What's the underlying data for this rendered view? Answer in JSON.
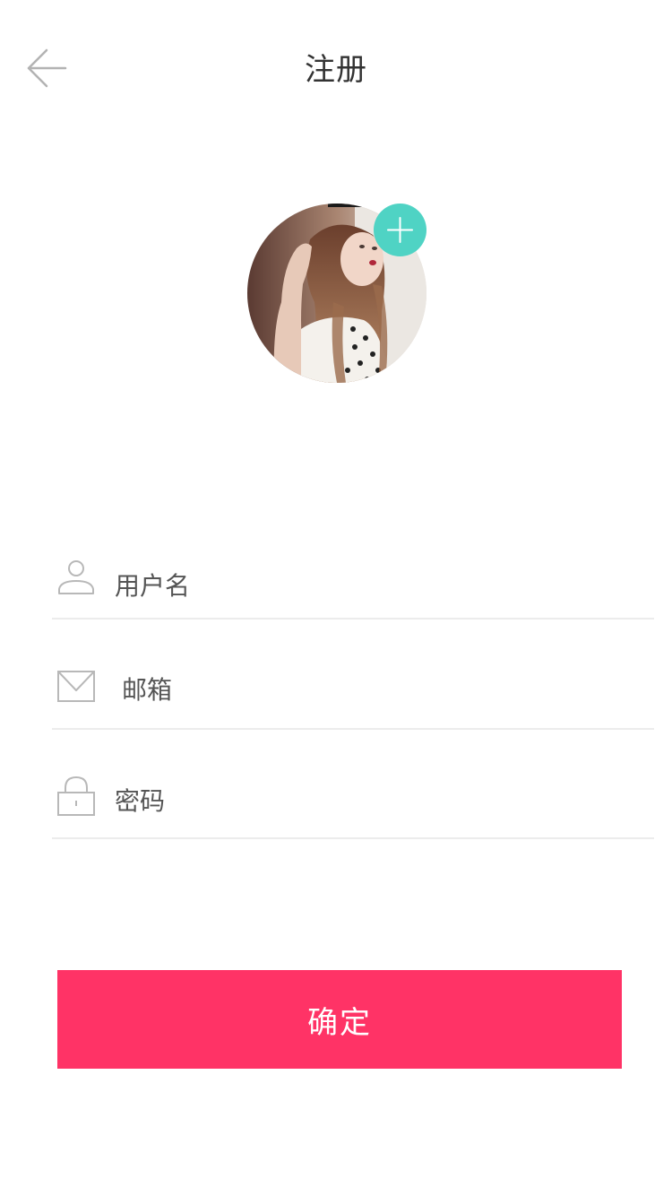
{
  "header": {
    "title": "注册",
    "back_icon": "arrow-left-icon"
  },
  "avatar": {
    "add_icon": "plus-icon",
    "accent_color": "#4fd3c4"
  },
  "form": {
    "username": {
      "icon": "user-icon",
      "placeholder": "用户名",
      "value": ""
    },
    "email": {
      "icon": "mail-icon",
      "placeholder": "邮箱",
      "value": ""
    },
    "password": {
      "icon": "lock-icon",
      "placeholder": "密码",
      "value": ""
    }
  },
  "submit": {
    "label": "确定",
    "color": "#ff3366"
  }
}
